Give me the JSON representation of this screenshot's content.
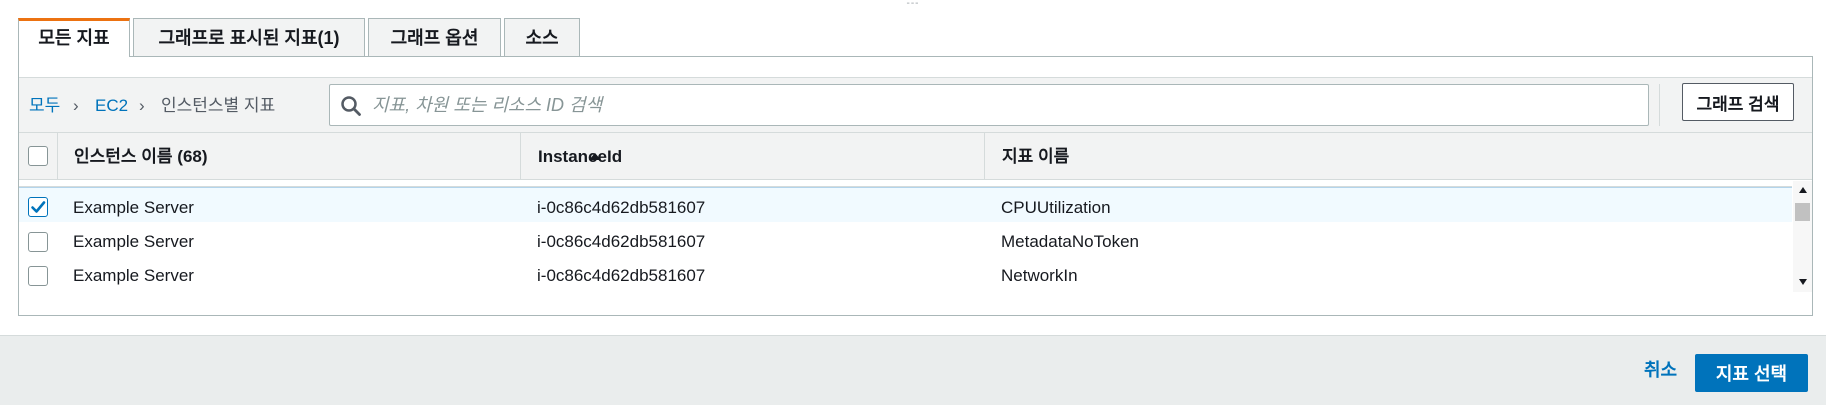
{
  "drag_handle_glyph": "---",
  "tabs": [
    {
      "label": "모든 지표",
      "active": true
    },
    {
      "label": "그래프로 표시된 지표(1)",
      "active": false
    },
    {
      "label": "그래프 옵션",
      "active": false
    },
    {
      "label": "소스",
      "active": false
    }
  ],
  "breadcrumb": {
    "items": [
      "모두",
      "EC2",
      "인스턴스별 지표"
    ],
    "separator": "›"
  },
  "search": {
    "placeholder": "지표, 차원 또는 리소스 ID 검색",
    "value": ""
  },
  "graph_search_label": "그래프 검색",
  "table": {
    "columns": [
      "인스턴스 이름 (68)",
      "InstanceId",
      "지표 이름"
    ],
    "sort_column": "인스턴스 이름 (68)",
    "sort_direction": "ascending",
    "rows": [
      {
        "checked": true,
        "name": "Example Server",
        "instance_id": "i-0c86c4d62db581607",
        "metric": "CPUUtilization"
      },
      {
        "checked": false,
        "name": "Example Server",
        "instance_id": "i-0c86c4d62db581607",
        "metric": "MetadataNoToken"
      },
      {
        "checked": false,
        "name": "Example Server",
        "instance_id": "i-0c86c4d62db581607",
        "metric": "NetworkIn"
      }
    ]
  },
  "footer": {
    "cancel_label": "취소",
    "select_label": "지표 선택"
  },
  "colors": {
    "accent": "#ec7211",
    "link": "#0073bb",
    "primary_button": "#0073bb",
    "selected_row": "#f1faff"
  }
}
